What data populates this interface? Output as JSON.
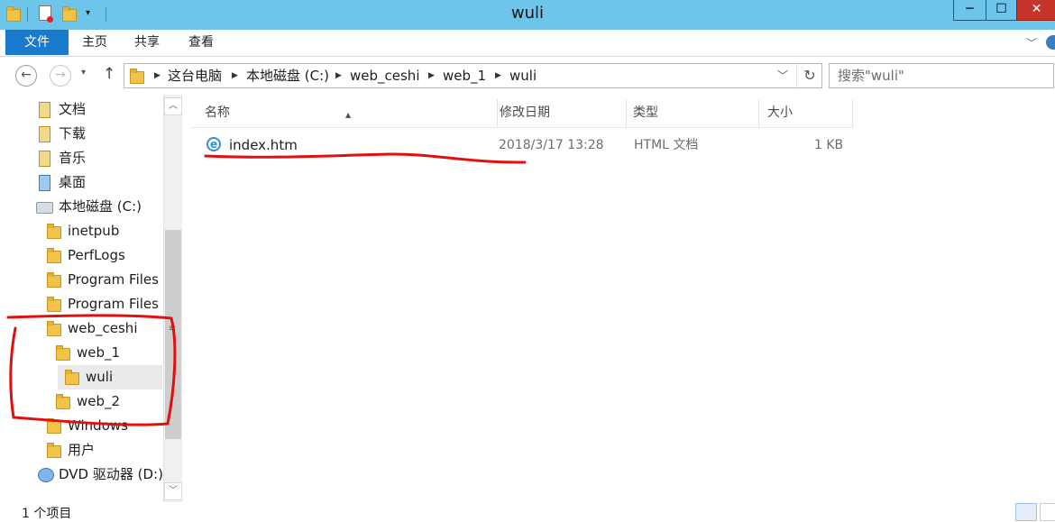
{
  "window": {
    "title": "wuli",
    "controls": {
      "minimize": "─",
      "maximize": "☐",
      "close": "✕"
    }
  },
  "ribbon": {
    "tabs": [
      "文件",
      "主页",
      "共享",
      "查看"
    ],
    "active_color": "#1979ca"
  },
  "navigation": {
    "back_icon": "back-arrow-icon",
    "forward_icon": "forward-arrow-icon",
    "up_icon": "up-arrow-icon",
    "breadcrumb": [
      "这台电脑",
      "本地磁盘 (C:)",
      "web_ceshi",
      "web_1",
      "wuli"
    ],
    "search_placeholder": "搜索\"wuli\""
  },
  "tree": [
    {
      "label": "文档",
      "icon": "documents-library-icon"
    },
    {
      "label": "下载",
      "icon": "downloads-icon"
    },
    {
      "label": "音乐",
      "icon": "music-library-icon"
    },
    {
      "label": "桌面",
      "icon": "desktop-icon"
    },
    {
      "label": "本地磁盘 (C:)",
      "icon": "local-disk-icon"
    },
    {
      "label": "inetpub",
      "icon": "folder-icon"
    },
    {
      "label": "PerfLogs",
      "icon": "folder-icon"
    },
    {
      "label": "Program Files",
      "icon": "folder-icon"
    },
    {
      "label": "Program Files (",
      "icon": "folder-icon"
    },
    {
      "label": "web_ceshi",
      "icon": "folder-icon"
    },
    {
      "label": "web_1",
      "icon": "folder-icon"
    },
    {
      "label": "wuli",
      "icon": "folder-icon",
      "selected": true
    },
    {
      "label": "web_2",
      "icon": "folder-icon"
    },
    {
      "label": "Windows",
      "icon": "folder-icon"
    },
    {
      "label": "用户",
      "icon": "folder-icon"
    },
    {
      "label": "DVD 驱动器 (D:) I",
      "icon": "dvd-drive-icon"
    }
  ],
  "columns": [
    "名称",
    "修改日期",
    "类型",
    "大小"
  ],
  "files": [
    {
      "name": "index.htm",
      "modified": "2018/3/17 13:28",
      "type": "HTML 文档",
      "size": "1 KB",
      "icon": "ie-html-icon"
    }
  ],
  "status": {
    "item_count": "1 个项目"
  },
  "annotation_color": "#e01010"
}
